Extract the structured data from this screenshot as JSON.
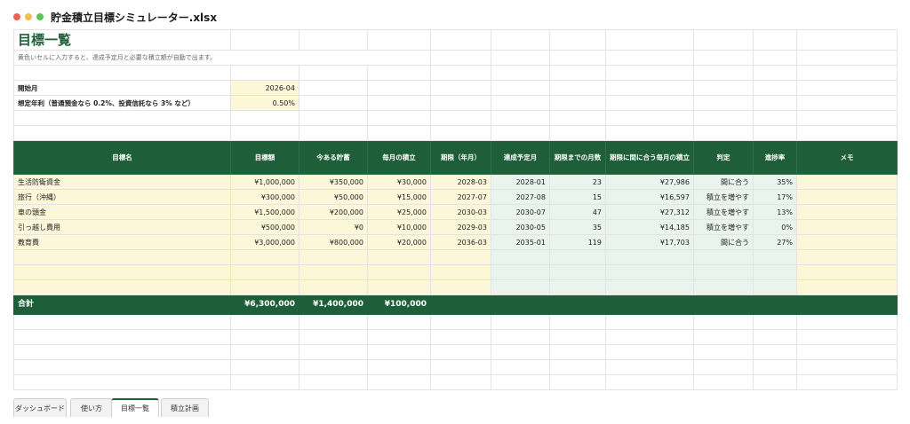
{
  "window": {
    "title": "貯金積立目標シミュレーター.xlsx"
  },
  "sheet": {
    "title": "目標一覧",
    "note": "黄色いセルに入力すると、達成予定月と必要な積立額が自動で出ます。",
    "start_label": "開始月",
    "start_value": "2026-04",
    "rate_label": "想定年利（普通預金なら 0.2%、投資信託なら 3% など）",
    "rate_value": "0.50%",
    "headers": [
      "目標名",
      "目標額",
      "今ある貯蓄",
      "毎月の積立",
      "期限（年月）",
      "達成予定月",
      "期限までの月数",
      "期限に間に合う毎月の積立",
      "判定",
      "進捗率",
      "メモ"
    ],
    "rows": [
      [
        "生活防衛資金",
        "¥1,000,000",
        "¥350,000",
        "¥30,000",
        "2028-03",
        "2028-01",
        "23",
        "¥27,986",
        "間に合う",
        "35%",
        ""
      ],
      [
        "旅行（沖縄）",
        "¥300,000",
        "¥50,000",
        "¥15,000",
        "2027-07",
        "2027-08",
        "15",
        "¥16,597",
        "積立を増やす",
        "17%",
        ""
      ],
      [
        "車の頭金",
        "¥1,500,000",
        "¥200,000",
        "¥25,000",
        "2030-03",
        "2030-07",
        "47",
        "¥27,312",
        "積立を増やす",
        "13%",
        ""
      ],
      [
        "引っ越し費用",
        "¥500,000",
        "¥0",
        "¥10,000",
        "2029-03",
        "2030-05",
        "35",
        "¥14,185",
        "積立を増やす",
        "0%",
        ""
      ],
      [
        "教育費",
        "¥3,000,000",
        "¥800,000",
        "¥20,000",
        "2036-03",
        "2035-01",
        "119",
        "¥17,703",
        "間に合う",
        "27%",
        ""
      ]
    ],
    "totals": {
      "label": "合計",
      "target": "¥6,300,000",
      "savings": "¥1,400,000",
      "monthly": "¥100,000"
    }
  },
  "tabs": [
    {
      "label": "ダッシュボード",
      "active": false
    },
    {
      "label": "使い方",
      "active": false
    },
    {
      "label": "目標一覧",
      "active": true
    },
    {
      "label": "積立計画",
      "active": false
    }
  ],
  "colors": {
    "header_green": "#1e5f3a",
    "input_yellow": "#fdf7da",
    "calc_green": "#e9f4ec"
  }
}
